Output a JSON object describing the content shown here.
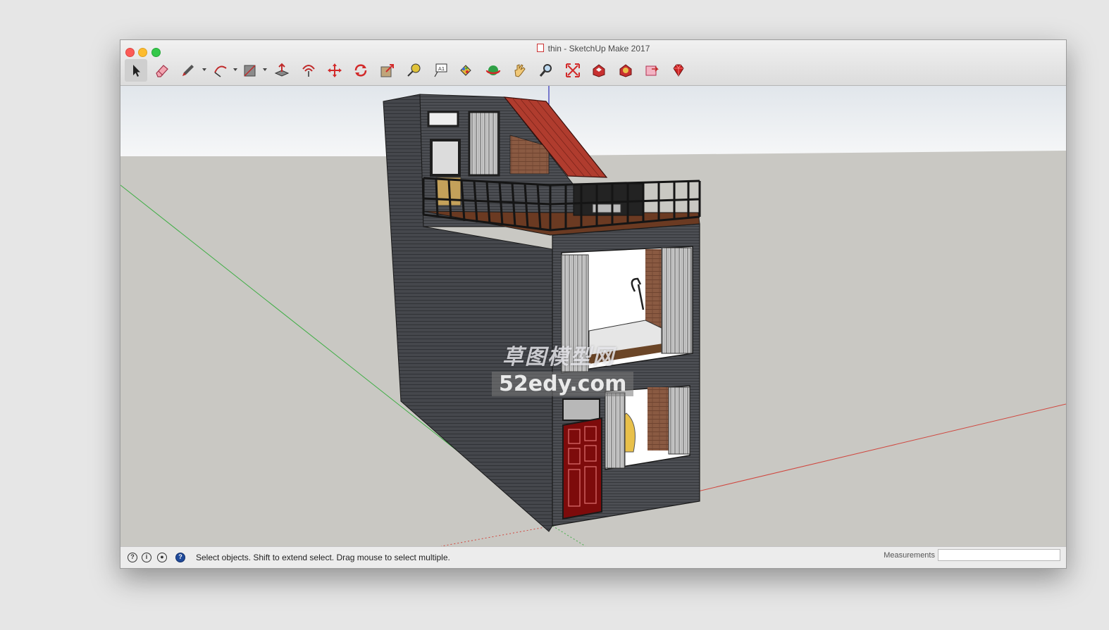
{
  "window": {
    "title": "thin - SketchUp Make 2017"
  },
  "toolbar": {
    "tools": [
      {
        "name": "select-tool",
        "icon": "arrow-cursor-icon"
      },
      {
        "name": "eraser-tool",
        "icon": "eraser-icon"
      },
      {
        "name": "pencil-tool",
        "icon": "pencil-icon"
      },
      {
        "name": "arc-tool",
        "icon": "arc-icon"
      },
      {
        "name": "shape-tool",
        "icon": "rectangle-icon"
      },
      {
        "name": "push-pull-tool",
        "icon": "push-pull-icon"
      },
      {
        "name": "offset-tool",
        "icon": "offset-icon"
      },
      {
        "name": "move-tool",
        "icon": "move-icon"
      },
      {
        "name": "rotate-tool",
        "icon": "rotate-icon"
      },
      {
        "name": "scale-tool",
        "icon": "scale-icon"
      },
      {
        "name": "tape-measure-tool",
        "icon": "tape-measure-icon"
      },
      {
        "name": "text-tool",
        "icon": "text-icon"
      },
      {
        "name": "paint-bucket-tool",
        "icon": "paint-bucket-icon"
      },
      {
        "name": "orbit-tool",
        "icon": "orbit-icon"
      },
      {
        "name": "pan-tool",
        "icon": "hand-icon"
      },
      {
        "name": "zoom-tool",
        "icon": "magnifier-icon"
      },
      {
        "name": "zoom-extents-tool",
        "icon": "zoom-extents-icon"
      },
      {
        "name": "3d-warehouse-tool",
        "icon": "warehouse-icon"
      },
      {
        "name": "extension-warehouse-tool",
        "icon": "extension-warehouse-icon"
      },
      {
        "name": "send-to-layout-tool",
        "icon": "layout-icon"
      },
      {
        "name": "extension-manager-tool",
        "icon": "ruby-gem-icon"
      }
    ]
  },
  "watermark": {
    "chinese": "草图模型网",
    "site": "52edy.com"
  },
  "statusbar": {
    "text": "Select objects. Shift to extend select. Drag mouse to select multiple.",
    "measurements_label": "Measurements",
    "measurements_value": ""
  },
  "colors": {
    "wall": "#4b4d52",
    "roof": "#b03c2e",
    "door": "#7d0b0b",
    "ground": "#c9c8c3",
    "sky_top": "#e7ebef",
    "axis_red": "#d0473f",
    "axis_green": "#3fae45",
    "axis_blue": "#2d2db6"
  }
}
